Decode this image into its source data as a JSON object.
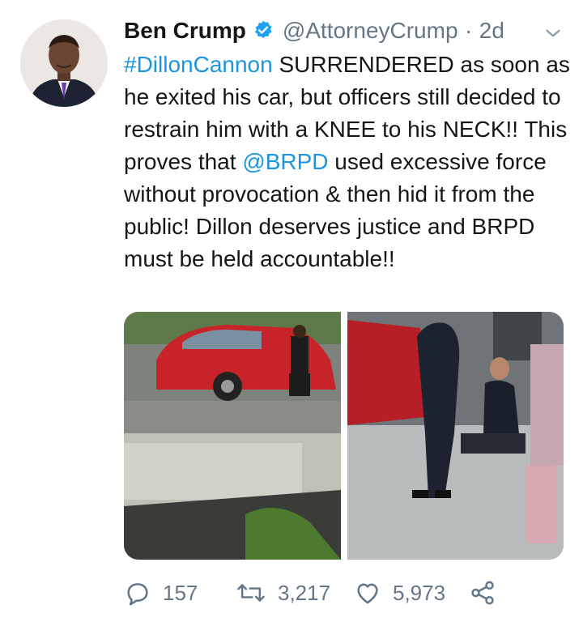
{
  "author": {
    "name": "Ben Crump",
    "handle": "@AttorneyCrump",
    "separator": "·",
    "time": "2d"
  },
  "tweet": {
    "hashtag": "#DillonCannon",
    "text_part1": " SURRENDERED as soon as he exited his car, but officers still decided to restrain him with a KNEE to his NECK!! This proves that ",
    "mention": "@BRPD",
    "text_part2": " used excessive force without provocation & then hid it from the public! Dillon deserves justice and BRPD must be held accountable!!"
  },
  "stats": {
    "replies": "157",
    "retweets": "3,217",
    "likes": "5,973"
  },
  "colors": {
    "link": "#1b95e0",
    "muted": "#657786",
    "verified": "#1da1f2"
  }
}
